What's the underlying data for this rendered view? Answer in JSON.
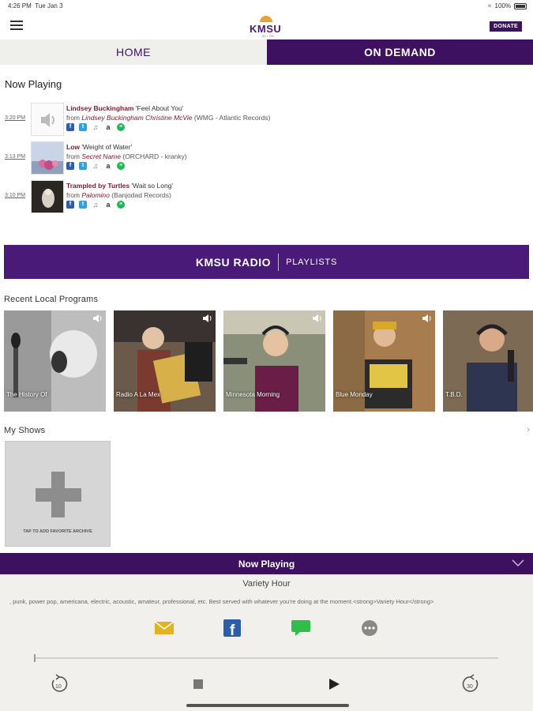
{
  "status_bar": {
    "time": "4:26 PM",
    "date": "Tue Jan 3",
    "battery": "100%"
  },
  "app_bar": {
    "logo_text": "KMSU",
    "logo_sub": "89.7 FM",
    "donate_label": "DONATE"
  },
  "tabs": [
    {
      "label": "HOME",
      "active": false
    },
    {
      "label": "ON DEMAND",
      "active": true
    }
  ],
  "now_playing": {
    "title": "Now Playing",
    "tracks": [
      {
        "time": "3:20 PM",
        "artist": "Lindsey Buckingham",
        "song": "'Feel About You'",
        "from_prefix": "from",
        "album": "Lindsey Buckingham Christine McVie",
        "label": "(WMG - Atlantic Records)"
      },
      {
        "time": "3:13 PM",
        "artist": "Low",
        "song": "'Weight of Water'",
        "from_prefix": "from",
        "album": "Secret Name",
        "label": "(ORCHARD - kranky)"
      },
      {
        "time": "3:10 PM",
        "artist": "Trampled by Turtles",
        "song": "'Wait so Long'",
        "from_prefix": "from",
        "album": "Palomino",
        "label": "(Banjodad Records)"
      }
    ]
  },
  "banner": {
    "left": "KMSU RADIO",
    "right": "PLAYLISTS"
  },
  "recent_programs": {
    "title": "Recent Local Programs",
    "items": [
      {
        "caption": "The History Of"
      },
      {
        "caption": "Radio A La Mex"
      },
      {
        "caption": "Minnesota Morning"
      },
      {
        "caption": "Blue Monday"
      },
      {
        "caption": "T.B.D."
      }
    ]
  },
  "my_shows": {
    "title": "My Shows",
    "add_label": "TAP TO ADD FAVORITE ARCHIVE"
  },
  "player": {
    "bar_title": "Now Playing",
    "show_name": "Variety Hour",
    "description": ", punk, power pop, americana, electric, acoustic, amateur, professional, etc.  Best served with whatever you're doing at the moment.<strong>Variety Hour</strong>",
    "progress": 0.0,
    "rewind_label": "10",
    "forward_label": "30"
  },
  "colors": {
    "brand_purple": "#3d1060",
    "banner_purple": "#4a1a78",
    "artist_red": "#8b1a2e",
    "spotify_green": "#1db954"
  }
}
